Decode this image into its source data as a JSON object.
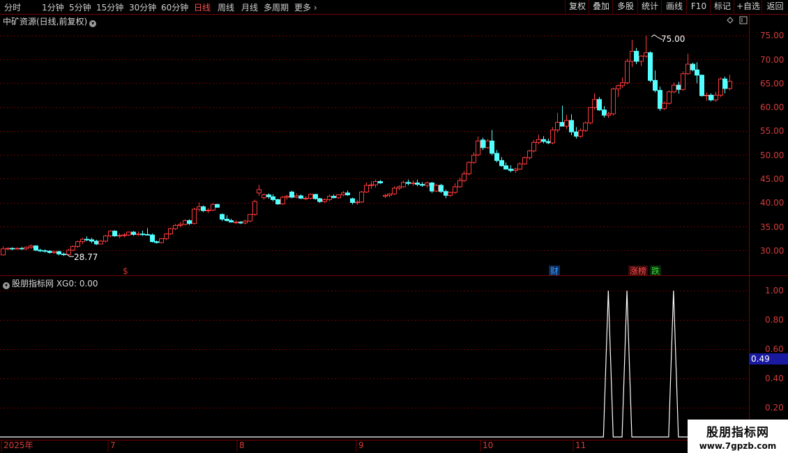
{
  "toolbar": {
    "periods": [
      "分时",
      "1分钟",
      "5分钟",
      "15分钟",
      "30分钟",
      "60分钟",
      "日线",
      "周线",
      "月线",
      "多周期",
      "更多"
    ],
    "active_period": "日线",
    "right_buttons": [
      "复权",
      "叠加",
      "多股",
      "统计",
      "画线",
      "F10",
      "标记",
      "+自选",
      "返回"
    ]
  },
  "stock": {
    "title": "中矿资源(日线,前复权)",
    "high_label": "75.00",
    "low_label": "28.77",
    "price_axis": [
      "75.00",
      "70.00",
      "65.00",
      "60.00",
      "55.00",
      "50.00",
      "45.00",
      "40.00",
      "35.00",
      "30.00"
    ],
    "event_markers": [
      {
        "text": "$",
        "color": "#e03030"
      },
      {
        "text": "财",
        "color": "#3a7fd5"
      },
      {
        "text": "涨榜",
        "color": "#e03030"
      },
      {
        "text": "跌",
        "color": "#30b030"
      }
    ]
  },
  "indicator": {
    "title": "股朋指标网 XG0: 0.00",
    "axis": [
      "1.00",
      "0.80",
      "0.60",
      "0.40",
      "0.20"
    ],
    "current_value": "0.49"
  },
  "date_axis": [
    "2025年",
    "7",
    "8",
    "9",
    "10",
    "11"
  ],
  "watermark": {
    "line1": "股朋指标网",
    "line2": "www.7gpzb.com"
  },
  "colors": {
    "up": "#ff3c3c",
    "down": "#54ffff",
    "grid": "#6e0000",
    "line": "#ffffff",
    "highlight": "#1a1aa0"
  },
  "chart_data": {
    "type": "candlestick",
    "ylim": [
      25,
      77
    ],
    "candles": [
      [
        29.0,
        30.8,
        28.9,
        30.3
      ],
      [
        30.3,
        30.6,
        30.0,
        30.4
      ],
      [
        30.4,
        30.6,
        30.0,
        30.3
      ],
      [
        30.3,
        30.6,
        30.1,
        30.4
      ],
      [
        30.4,
        30.7,
        30.1,
        30.3
      ],
      [
        30.3,
        30.8,
        30.0,
        30.6
      ],
      [
        30.6,
        31.2,
        30.3,
        30.9
      ],
      [
        30.9,
        31.0,
        29.8,
        30.0
      ],
      [
        30.0,
        30.3,
        29.6,
        29.9
      ],
      [
        29.9,
        30.2,
        29.5,
        29.8
      ],
      [
        29.8,
        30.0,
        29.3,
        29.5
      ],
      [
        29.5,
        29.9,
        29.2,
        29.7
      ],
      [
        29.7,
        29.9,
        28.9,
        29.2
      ],
      [
        29.2,
        29.5,
        28.77,
        29.1
      ],
      [
        29.1,
        30.3,
        29.0,
        30.0
      ],
      [
        30.0,
        31.0,
        29.8,
        30.8
      ],
      [
        30.8,
        32.0,
        30.5,
        31.8
      ],
      [
        31.8,
        32.6,
        31.3,
        32.3
      ],
      [
        32.3,
        32.9,
        31.9,
        32.2
      ],
      [
        32.2,
        32.6,
        31.5,
        31.9
      ],
      [
        31.9,
        32.2,
        31.1,
        31.3
      ],
      [
        31.3,
        32.1,
        31.2,
        31.9
      ],
      [
        31.9,
        33.2,
        31.6,
        33.0
      ],
      [
        33.0,
        34.2,
        32.7,
        34.0
      ],
      [
        34.0,
        34.2,
        32.8,
        33.0
      ],
      [
        33.0,
        33.5,
        32.5,
        33.1
      ],
      [
        33.1,
        33.6,
        32.7,
        33.2
      ],
      [
        33.2,
        33.9,
        33.0,
        33.8
      ],
      [
        33.8,
        34.0,
        33.0,
        33.3
      ],
      [
        33.3,
        33.9,
        33.0,
        33.4
      ],
      [
        33.4,
        34.1,
        33.0,
        33.3
      ],
      [
        33.3,
        34.6,
        33.1,
        33.2
      ],
      [
        33.2,
        33.5,
        31.6,
        31.8
      ],
      [
        31.8,
        32.0,
        31.4,
        31.6
      ],
      [
        31.6,
        32.5,
        31.4,
        32.4
      ],
      [
        32.4,
        33.6,
        32.1,
        33.4
      ],
      [
        33.4,
        34.7,
        33.2,
        34.5
      ],
      [
        34.5,
        35.5,
        34.2,
        35.2
      ],
      [
        35.2,
        35.9,
        34.8,
        35.4
      ],
      [
        35.4,
        36.5,
        35.2,
        36.2
      ],
      [
        36.2,
        36.5,
        35.3,
        35.6
      ],
      [
        35.6,
        38.9,
        35.4,
        38.6
      ],
      [
        38.6,
        40.0,
        38.1,
        39.1
      ],
      [
        39.1,
        39.4,
        38.0,
        38.3
      ],
      [
        38.3,
        38.8,
        37.8,
        38.4
      ],
      [
        38.4,
        39.9,
        38.2,
        39.6
      ],
      [
        39.6,
        39.7,
        38.9,
        39.0
      ],
      [
        37.5,
        37.7,
        36.1,
        36.5
      ],
      [
        36.5,
        37.3,
        36.0,
        36.2
      ],
      [
        36.2,
        36.6,
        35.8,
        35.9
      ],
      [
        35.9,
        36.3,
        35.5,
        35.9
      ],
      [
        35.9,
        36.1,
        35.5,
        35.7
      ],
      [
        35.7,
        36.4,
        35.4,
        36.1
      ],
      [
        36.1,
        37.6,
        35.9,
        37.5
      ],
      [
        37.5,
        40.6,
        37.2,
        40.2
      ],
      [
        42.0,
        43.7,
        41.4,
        42.7
      ],
      [
        41.0,
        41.9,
        40.6,
        41.6
      ],
      [
        41.6,
        41.9,
        40.8,
        41.2
      ],
      [
        41.2,
        41.7,
        40.2,
        40.6
      ],
      [
        40.6,
        40.8,
        39.5,
        39.7
      ],
      [
        39.7,
        41.4,
        39.5,
        41.1
      ],
      [
        41.1,
        41.6,
        40.6,
        41.3
      ],
      [
        42.2,
        42.5,
        40.9,
        41.1
      ],
      [
        41.1,
        41.9,
        40.9,
        41.4
      ],
      [
        41.4,
        41.7,
        40.7,
        40.9
      ],
      [
        40.9,
        41.3,
        40.5,
        40.9
      ],
      [
        40.9,
        41.9,
        40.7,
        41.7
      ],
      [
        41.7,
        41.8,
        40.6,
        40.8
      ],
      [
        40.8,
        41.0,
        39.9,
        40.2
      ],
      [
        40.2,
        40.9,
        39.9,
        40.6
      ],
      [
        40.6,
        41.7,
        40.3,
        41.3
      ],
      [
        41.3,
        41.7,
        40.9,
        41.0
      ],
      [
        41.0,
        41.7,
        40.8,
        41.6
      ],
      [
        41.6,
        42.4,
        41.3,
        42.0
      ],
      [
        42.0,
        42.5,
        41.4,
        41.6
      ],
      [
        40.8,
        41.0,
        39.6,
        40.0
      ],
      [
        40.0,
        40.5,
        39.5,
        40.1
      ],
      [
        40.1,
        42.4,
        39.9,
        42.2
      ],
      [
        42.2,
        44.2,
        42.0,
        43.6
      ],
      [
        43.6,
        44.5,
        42.9,
        43.7
      ],
      [
        43.7,
        44.8,
        43.1,
        44.4
      ],
      [
        44.4,
        44.7,
        43.9,
        44.1
      ],
      [
        41.3,
        41.8,
        40.9,
        41.5
      ],
      [
        41.5,
        42.0,
        41.1,
        41.8
      ],
      [
        41.8,
        43.4,
        41.6,
        43.0
      ],
      [
        43.0,
        43.6,
        42.6,
        43.3
      ],
      [
        43.3,
        44.6,
        43.1,
        44.2
      ],
      [
        44.2,
        44.8,
        43.6,
        44.0
      ],
      [
        44.0,
        44.6,
        43.5,
        44.1
      ],
      [
        44.1,
        44.8,
        43.4,
        43.8
      ],
      [
        43.8,
        44.3,
        43.3,
        43.6
      ],
      [
        43.6,
        44.4,
        43.1,
        44.1
      ],
      [
        44.1,
        44.3,
        42.0,
        42.4
      ],
      [
        42.4,
        43.9,
        42.2,
        43.6
      ],
      [
        43.6,
        43.9,
        42.0,
        42.3
      ],
      [
        42.3,
        42.7,
        40.9,
        41.5
      ],
      [
        41.5,
        42.3,
        41.2,
        42.1
      ],
      [
        42.1,
        44.0,
        41.8,
        43.3
      ],
      [
        43.3,
        45.2,
        43.1,
        44.6
      ],
      [
        44.6,
        46.6,
        44.3,
        46.0
      ],
      [
        46.0,
        48.6,
        45.7,
        48.4
      ],
      [
        48.4,
        50.5,
        48.1,
        49.9
      ],
      [
        50.0,
        53.8,
        49.7,
        52.9
      ],
      [
        53.1,
        53.6,
        51.0,
        51.5
      ],
      [
        51.5,
        53.3,
        51.3,
        52.9
      ],
      [
        52.9,
        55.2,
        49.9,
        50.3
      ],
      [
        50.3,
        51.0,
        48.4,
        48.8
      ],
      [
        48.8,
        49.5,
        47.5,
        47.7
      ],
      [
        47.7,
        48.4,
        46.9,
        47.0
      ],
      [
        47.0,
        47.8,
        46.3,
        46.7
      ],
      [
        46.7,
        47.3,
        46.2,
        47.0
      ],
      [
        47.0,
        48.4,
        46.8,
        48.1
      ],
      [
        48.1,
        49.6,
        47.9,
        49.4
      ],
      [
        49.4,
        51.1,
        49.0,
        50.8
      ],
      [
        50.8,
        53.1,
        50.5,
        52.6
      ],
      [
        52.6,
        54.2,
        52.2,
        53.2
      ],
      [
        53.2,
        53.9,
        52.4,
        52.8
      ],
      [
        52.8,
        53.4,
        52.2,
        52.5
      ],
      [
        52.5,
        55.8,
        52.2,
        55.2
      ],
      [
        55.2,
        58.8,
        54.7,
        56.8
      ],
      [
        56.8,
        60.3,
        56.2,
        56.0
      ],
      [
        56.0,
        58.4,
        55.4,
        57.2
      ],
      [
        57.2,
        58.5,
        54.1,
        54.8
      ],
      [
        54.8,
        55.8,
        53.4,
        53.9
      ],
      [
        53.9,
        55.5,
        53.6,
        55.1
      ],
      [
        55.1,
        57.0,
        54.8,
        56.7
      ],
      [
        56.7,
        60.0,
        56.4,
        59.9
      ],
      [
        59.9,
        62.9,
        59.5,
        61.6
      ],
      [
        61.6,
        62.1,
        59.2,
        59.4
      ],
      [
        59.4,
        60.2,
        57.8,
        58.3
      ],
      [
        58.3,
        59.0,
        57.7,
        58.6
      ],
      [
        58.6,
        64.1,
        58.2,
        63.8
      ],
      [
        63.8,
        64.7,
        62.1,
        64.5
      ],
      [
        64.5,
        66.2,
        64.0,
        65.1
      ],
      [
        65.1,
        70.1,
        64.8,
        69.6
      ],
      [
        69.6,
        74.1,
        68.4,
        71.7
      ],
      [
        71.7,
        72.4,
        69.0,
        69.6
      ],
      [
        69.6,
        70.9,
        68.6,
        70.7
      ],
      [
        70.7,
        75.0,
        70.3,
        71.4
      ],
      [
        71.4,
        71.7,
        65.2,
        65.6
      ],
      [
        65.6,
        67.7,
        63.1,
        63.5
      ],
      [
        63.5,
        64.3,
        59.2,
        59.7
      ],
      [
        59.7,
        61.2,
        59.4,
        60.8
      ],
      [
        60.8,
        63.5,
        60.5,
        63.2
      ],
      [
        63.2,
        65.2,
        62.9,
        64.6
      ],
      [
        64.6,
        65.3,
        62.8,
        63.7
      ],
      [
        63.7,
        67.5,
        63.4,
        67.0
      ],
      [
        67.0,
        71.2,
        66.8,
        69.0
      ],
      [
        69.0,
        69.3,
        67.5,
        67.8
      ],
      [
        67.8,
        69.4,
        65.0,
        66.7
      ],
      [
        66.7,
        66.8,
        62.2,
        62.4
      ],
      [
        62.4,
        63.1,
        61.3,
        62.5
      ],
      [
        62.5,
        62.9,
        61.2,
        61.5
      ],
      [
        61.5,
        63.2,
        61.1,
        62.5
      ],
      [
        62.5,
        66.2,
        62.1,
        65.9
      ],
      [
        65.9,
        66.4,
        62.9,
        63.9
      ],
      [
        63.9,
        66.8,
        63.5,
        65.4
      ]
    ],
    "indicator": {
      "ylim": [
        0,
        1.1
      ],
      "spikes": [
        {
          "index": 130,
          "value": 1.0
        },
        {
          "index": 134,
          "value": 1.0
        },
        {
          "index": 144,
          "value": 1.0
        }
      ]
    }
  }
}
